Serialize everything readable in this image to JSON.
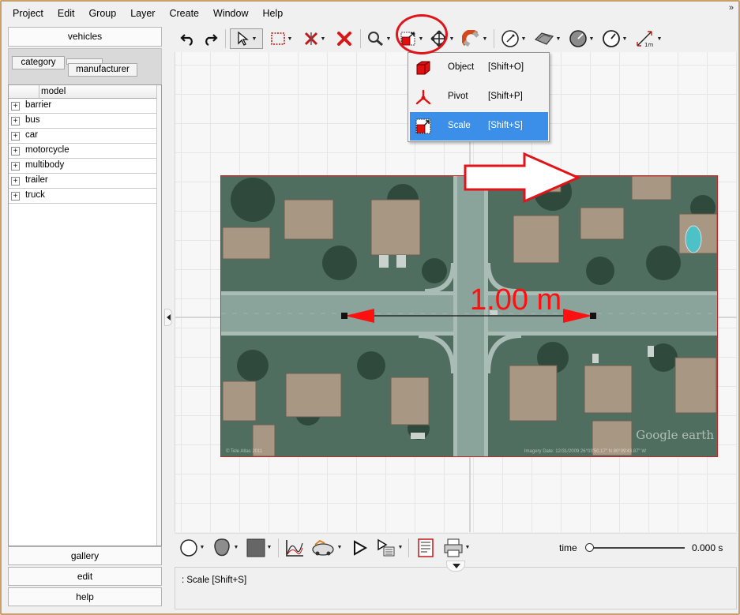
{
  "menu": [
    "Project",
    "Edit",
    "Group",
    "Layer",
    "Create",
    "Window",
    "Help"
  ],
  "overflow_glyph": "»",
  "left_panel": {
    "vehicles_label": "vehicles",
    "tabs": {
      "category": "category",
      "manufacturer": "manufacturer"
    },
    "tree_column": "model",
    "tree_items": [
      {
        "label": "barrier"
      },
      {
        "label": "bus"
      },
      {
        "label": "car"
      },
      {
        "label": "motorcycle"
      },
      {
        "label": "multibody"
      },
      {
        "label": "trailer"
      },
      {
        "label": "truck"
      }
    ],
    "expand_glyph": "+",
    "bottom_buttons": {
      "gallery": "gallery",
      "edit": "edit",
      "help": "help"
    }
  },
  "toolbar": {
    "icons": [
      "undo-icon",
      "redo-icon",
      "select-pointer-icon",
      "select-rect-icon",
      "split-icon",
      "delete-icon",
      "zoom-icon",
      "scale-tool-icon",
      "move-icon",
      "magnet-icon",
      "measure-circle-icon",
      "surface-icon",
      "gauge-icon",
      "dial-icon",
      "measure-1m-icon"
    ]
  },
  "dropdown": {
    "items": [
      {
        "label": "Object",
        "shortcut": "[Shift+O]",
        "icon": "cube-icon"
      },
      {
        "label": "Pivot",
        "shortcut": "[Shift+P]",
        "icon": "pivot-icon"
      },
      {
        "label": "Scale",
        "shortcut": "[Shift+S]",
        "icon": "scale-icon",
        "highlighted": true
      }
    ]
  },
  "canvas": {
    "scale_label": "1.00 m",
    "image_watermark": "Google earth",
    "image_footer_left": "© Tele Atlas   2011",
    "image_footer_right": "Imagery Date: 12/31/2009   26°03'50.17\" N  80°09'43.87\" W"
  },
  "bottom_toolbar": {
    "time_label": "time",
    "time_value": "0.000 s",
    "time_position": 0.0
  },
  "status": {
    "text": ": Scale [Shift+S]"
  },
  "colors": {
    "annotation_red": "#e0141b",
    "highlight_blue": "#3b8fe8",
    "scale_red": "#ff1010"
  }
}
